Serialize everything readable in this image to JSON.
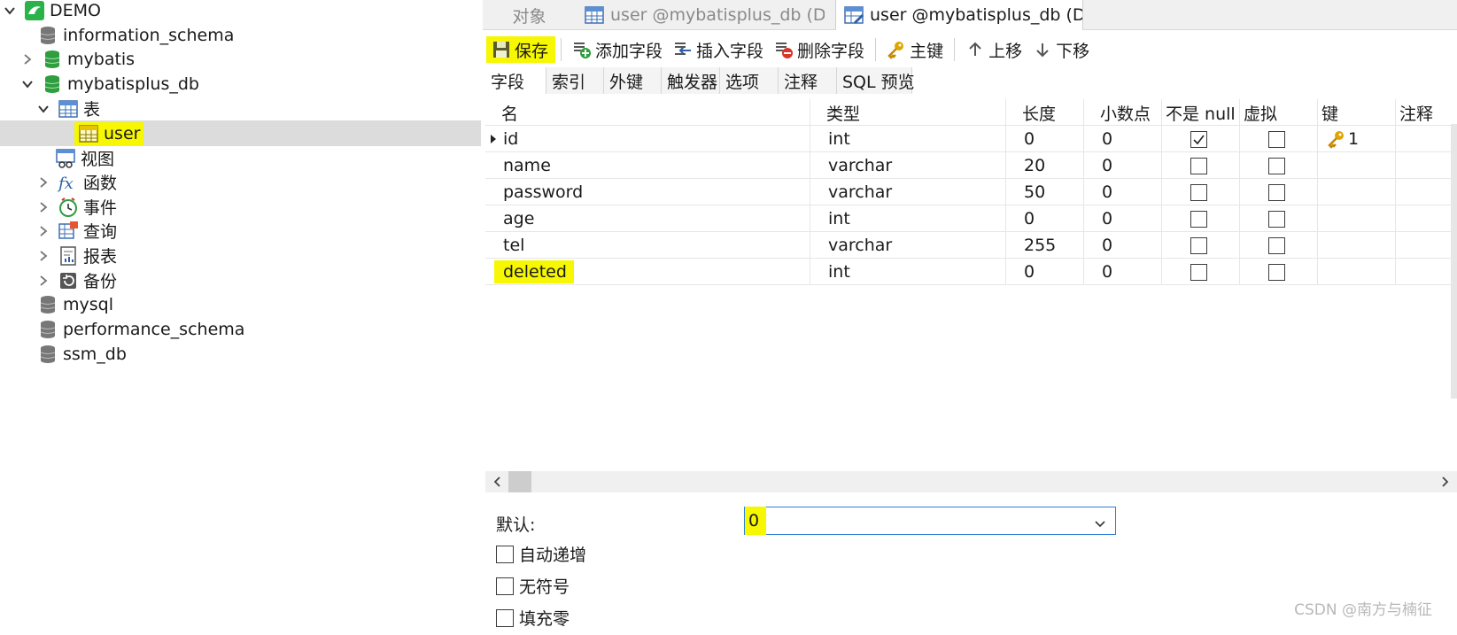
{
  "tree": {
    "connection": "DEMO",
    "items": [
      {
        "label": "information_schema",
        "icon": "database-gray-icon"
      },
      {
        "label": "mybatis",
        "icon": "database-green-icon"
      },
      {
        "label": "mybatisplus_db",
        "icon": "database-green-icon"
      },
      {
        "label": "表",
        "icon": "tables-folder-icon"
      },
      {
        "label": "user",
        "icon": "table-icon"
      },
      {
        "label": "视图",
        "icon": "views-icon"
      },
      {
        "label": "函数",
        "icon": "function-icon"
      },
      {
        "label": "事件",
        "icon": "event-icon"
      },
      {
        "label": "查询",
        "icon": "query-icon"
      },
      {
        "label": "报表",
        "icon": "report-icon"
      },
      {
        "label": "备份",
        "icon": "backup-icon"
      },
      {
        "label": "mysql",
        "icon": "database-gray-icon"
      },
      {
        "label": "performance_schema",
        "icon": "database-gray-icon"
      },
      {
        "label": "ssm_db",
        "icon": "database-gray-icon"
      }
    ]
  },
  "tabs": [
    {
      "label": "对象"
    },
    {
      "label": "user @mybatisplus_db (DE..."
    },
    {
      "label": "user @mybatisplus_db (DE..."
    }
  ],
  "toolbar": {
    "save": "保存",
    "add_field": "添加字段",
    "insert_field": "插入字段",
    "delete_field": "删除字段",
    "primary_key": "主键",
    "move_up": "上移",
    "move_down": "下移"
  },
  "subtabs": [
    "字段",
    "索引",
    "外键",
    "触发器",
    "选项",
    "注释",
    "SQL 预览"
  ],
  "grid": {
    "headers": [
      "名",
      "类型",
      "长度",
      "小数点",
      "不是 null",
      "虚拟",
      "键",
      "注释"
    ],
    "rows": [
      {
        "name": "id",
        "type": "int",
        "length": "0",
        "decimals": "0",
        "not_null": true,
        "virtual": false,
        "key": "1"
      },
      {
        "name": "name",
        "type": "varchar",
        "length": "20",
        "decimals": "0",
        "not_null": false,
        "virtual": false,
        "key": ""
      },
      {
        "name": "password",
        "type": "varchar",
        "length": "50",
        "decimals": "0",
        "not_null": false,
        "virtual": false,
        "key": ""
      },
      {
        "name": "age",
        "type": "int",
        "length": "0",
        "decimals": "0",
        "not_null": false,
        "virtual": false,
        "key": ""
      },
      {
        "name": "tel",
        "type": "varchar",
        "length": "255",
        "decimals": "0",
        "not_null": false,
        "virtual": false,
        "key": ""
      },
      {
        "name": "deleted",
        "type": "int",
        "length": "0",
        "decimals": "0",
        "not_null": false,
        "virtual": false,
        "key": ""
      }
    ]
  },
  "properties": {
    "default_label": "默认:",
    "default_value": "0",
    "auto_increment": "自动递增",
    "unsigned": "无符号",
    "zerofill": "填充零"
  },
  "watermark": "CSDN @南方与楠征",
  "colors": {
    "highlight": "#f6f700",
    "db_green": "#2e9e3e",
    "selection": "#dcdcdc"
  }
}
